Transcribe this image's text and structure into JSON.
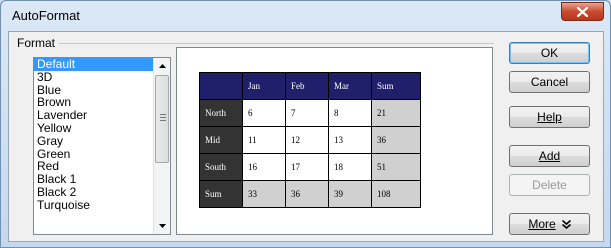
{
  "window": {
    "title": "AutoFormat"
  },
  "format_group": {
    "label": "Format"
  },
  "formats": [
    "Default",
    "3D",
    "Blue",
    "Brown",
    "Lavender",
    "Yellow",
    "Gray",
    "Green",
    "Red",
    "Black 1",
    "Black 2",
    "Turquoise"
  ],
  "selected_format": "Default",
  "preview": {
    "header": [
      "",
      "Jan",
      "Feb",
      "Mar",
      "Sum"
    ],
    "rows": [
      {
        "label": "North",
        "values": [
          "6",
          "7",
          "8"
        ],
        "sum": "21"
      },
      {
        "label": "Mid",
        "values": [
          "11",
          "12",
          "13"
        ],
        "sum": "36"
      },
      {
        "label": "South",
        "values": [
          "16",
          "17",
          "18"
        ],
        "sum": "51"
      },
      {
        "label": "Sum",
        "values": [
          "33",
          "36",
          "39"
        ],
        "sum": "108"
      }
    ]
  },
  "buttons": {
    "ok": "OK",
    "cancel": "Cancel",
    "help": "Help",
    "add": "Add",
    "delete": "Delete",
    "more": "More"
  },
  "icons": {
    "close": "close-icon",
    "more": "double-chevron-down-icon"
  },
  "colors": {
    "header_bg": "#1f1f6b",
    "rowhead_bg": "#333333",
    "sum_bg": "#d0d0d0",
    "selection": "#3399ff",
    "close": "#c94a2f"
  }
}
